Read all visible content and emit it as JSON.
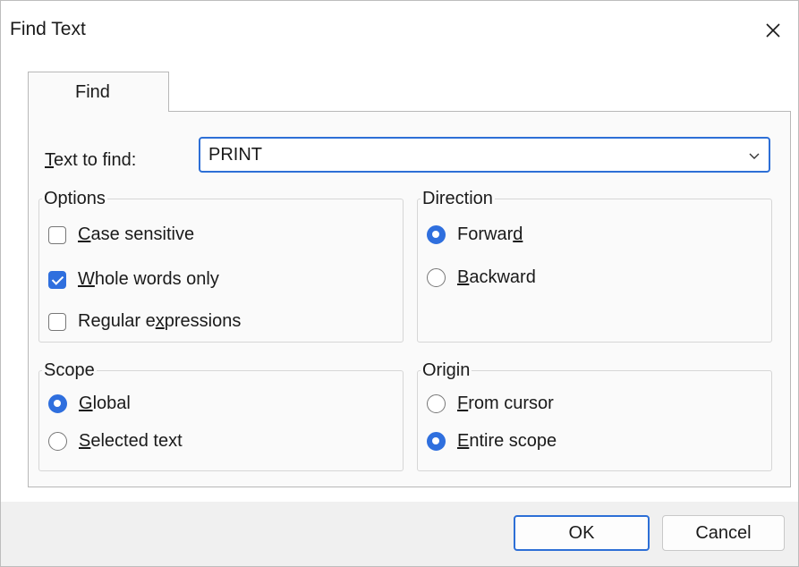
{
  "window": {
    "title": "Find Text",
    "close_icon": "close-icon"
  },
  "tabs": [
    {
      "label": "Find"
    }
  ],
  "find": {
    "label_mnemonic": "T",
    "label_rest": "ext to find:",
    "value": "PRINT"
  },
  "options": {
    "title": "Options",
    "case_sensitive": {
      "mnemonic": "C",
      "rest": "ase sensitive",
      "checked": false
    },
    "whole_words": {
      "mnemonic": "W",
      "rest": "hole words only",
      "checked": true
    },
    "regex": {
      "pre": "Regular e",
      "mnemonic": "x",
      "post": "pressions",
      "checked": false
    }
  },
  "direction": {
    "title": "Direction",
    "forward": {
      "pre": "Forwar",
      "mnemonic": "d",
      "selected": true
    },
    "backward": {
      "mnemonic": "B",
      "rest": "ackward",
      "selected": false
    }
  },
  "scope": {
    "title": "Scope",
    "global": {
      "mnemonic": "G",
      "rest": "lobal",
      "selected": true
    },
    "selected_text": {
      "mnemonic": "S",
      "rest": "elected text",
      "selected": false
    }
  },
  "origin": {
    "title": "Origin",
    "from_cursor": {
      "mnemonic": "F",
      "rest": "rom cursor",
      "selected": false
    },
    "entire_scope": {
      "mnemonic": "E",
      "rest": "ntire scope",
      "selected": true
    }
  },
  "buttons": {
    "ok": "OK",
    "cancel": "Cancel"
  },
  "colors": {
    "accent": "#2f6fde",
    "focus_border": "#2d6fd6"
  }
}
